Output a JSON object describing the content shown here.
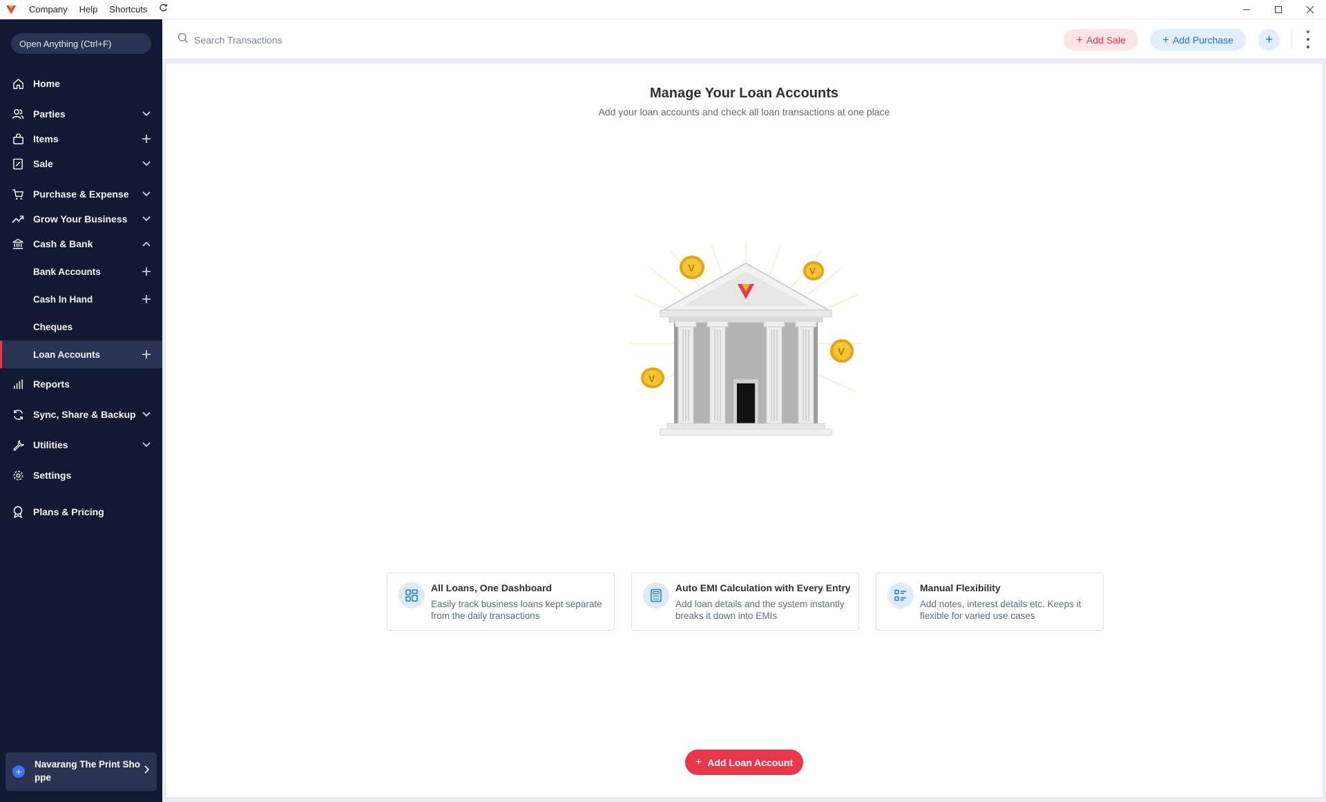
{
  "titlebar": {
    "menu": [
      "Company",
      "Help",
      "Shortcuts"
    ],
    "refresh_icon": "refresh-icon",
    "window_controls": [
      "minimize-icon",
      "maximize-icon",
      "close-icon"
    ]
  },
  "sidebar": {
    "open_anything": "Open Anything (Ctrl+F)",
    "items": [
      {
        "label": "Home",
        "icon": "home-icon"
      },
      {
        "label": "Parties",
        "icon": "users-icon",
        "trail": "chevron-down"
      },
      {
        "label": "Items",
        "icon": "bag-icon",
        "trail": "plus"
      },
      {
        "label": "Sale",
        "icon": "receipt-icon",
        "trail": "chevron-down"
      },
      {
        "label": "Purchase & Expense",
        "icon": "cart-icon",
        "trail": "chevron-down"
      },
      {
        "label": "Grow Your Business",
        "icon": "trend-icon",
        "trail": "chevron-down"
      },
      {
        "label": "Cash & Bank",
        "icon": "bank-icon",
        "trail": "chevron-up"
      },
      {
        "label": "Bank Accounts",
        "sub": true,
        "trail": "plus"
      },
      {
        "label": "Cash In Hand",
        "sub": true,
        "trail": "plus"
      },
      {
        "label": "Cheques",
        "sub": true
      },
      {
        "label": "Loan Accounts",
        "sub": true,
        "trail": "plus",
        "active": true
      },
      {
        "label": "Reports",
        "icon": "bars-icon"
      },
      {
        "label": "Sync, Share & Backup",
        "icon": "sync-icon",
        "trail": "chevron-down"
      },
      {
        "label": "Utilities",
        "icon": "wrench-icon",
        "trail": "chevron-down"
      },
      {
        "label": "Settings",
        "icon": "gear-icon"
      },
      {
        "label": "Plans & Pricing",
        "icon": "badge-icon"
      }
    ],
    "company_name": "Navarang The Print Shoppe"
  },
  "topbar": {
    "search_placeholder": "Search Transactions",
    "add_sale": "Add Sale",
    "add_purchase": "Add Purchase"
  },
  "main": {
    "title": "Manage Your Loan Accounts",
    "subtitle": "Add your loan accounts and check all loan transactions at one place",
    "cards": [
      {
        "title": "All Loans, One Dashboard",
        "desc": "Easily track business loans kept separate from the daily transactions",
        "icon": "dashboard-icon"
      },
      {
        "title": "Auto EMI Calculation with Every Entry",
        "desc": "Add loan details and the system instantly breaks it down into EMIs",
        "icon": "calculator-icon"
      },
      {
        "title": "Manual Flexibility",
        "desc": "Add notes, interest details etc. Keeps it flexible for varied use cases",
        "icon": "list-icon"
      }
    ],
    "add_loan_button": "Add Loan Account"
  },
  "colors": {
    "brand_red": "#e8364b",
    "sidebar_bg": "#121a33",
    "accent_blue": "#1b74d8"
  }
}
